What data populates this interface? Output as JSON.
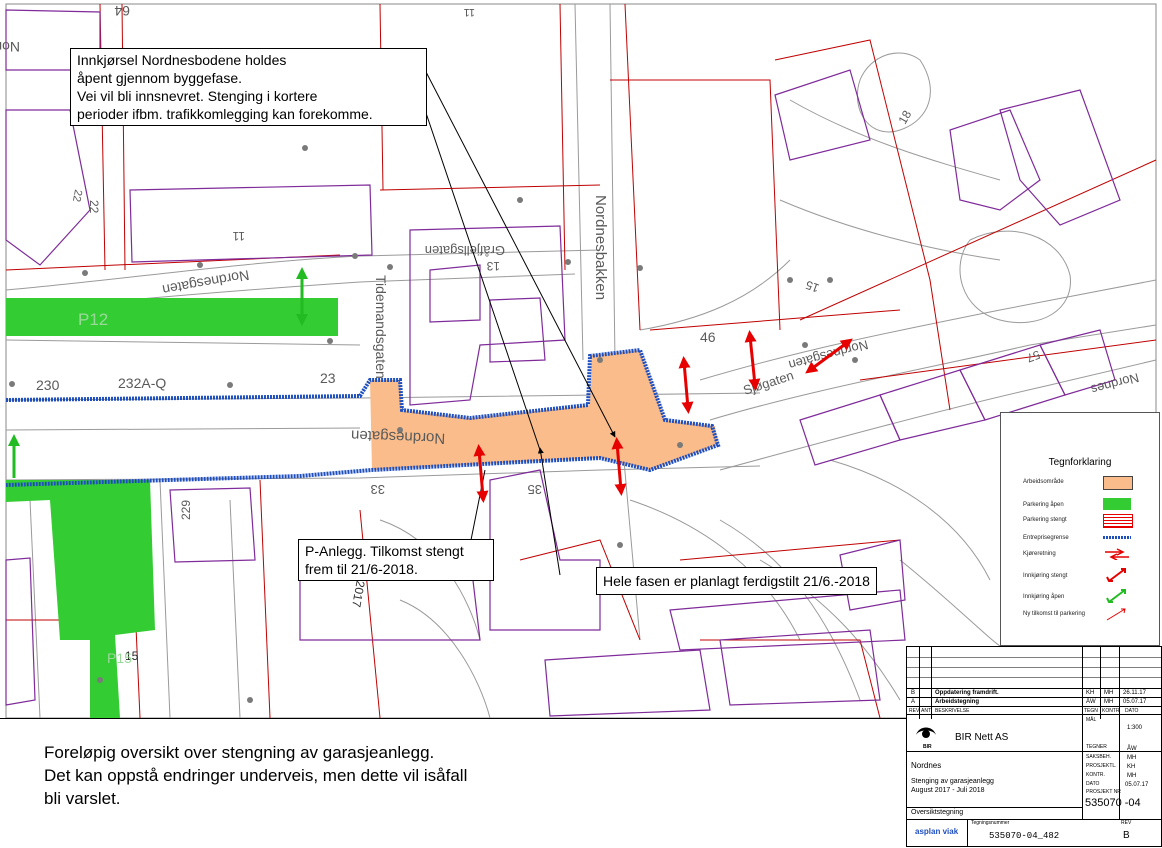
{
  "map": {
    "street_labels": [
      "Nordnesbodene",
      "Nordnesbakken",
      "Tidemandsgaten",
      "Nordnesgaten",
      "Gråfjellsgaten",
      "Nordnesgaten",
      "Sjøgaten",
      "Nordnesgaten",
      "Nordnes"
    ],
    "address_numbers": [
      "64",
      "11",
      "13",
      "22",
      "23",
      "230",
      "232A-Q",
      "33",
      "35",
      "46",
      "15",
      "18",
      "57",
      "22",
      "11",
      "15",
      "229",
      "2017"
    ],
    "area_labels": [
      "P12",
      "P15"
    ],
    "colors": {
      "work_area": "#f9bc8a",
      "parking_open": "#33cc33",
      "boundary": "#1f4fbf",
      "closed_arrow": "#e60000",
      "property_line": "#c00000",
      "building_outline": "#7f2b9a"
    }
  },
  "callouts": {
    "entrance": [
      "Innkjørsel Nordnesbodene holdes",
      "åpent gjennom byggefase.",
      "Vei vil bli innsnevret. Stenging i kortere",
      "perioder ifbm. trafikkomlegging kan forekomme."
    ],
    "parking": [
      "P-Anlegg. Tilkomst stengt",
      "frem til 21/6-2018."
    ],
    "phase": "Hele fasen er planlagt ferdigstilt 21/6.-2018"
  },
  "legend": {
    "title": "Tegnforklaring",
    "items": [
      {
        "label": "Arbeidsområde",
        "symbol": "work-area"
      },
      {
        "label": "Parkering åpen",
        "symbol": "parking-open"
      },
      {
        "label": "Parkering stengt",
        "symbol": "parking-closed"
      },
      {
        "label": "Entreprisegrense",
        "symbol": "boundary"
      },
      {
        "label": "Kjøreretning",
        "symbol": "driving-direction"
      },
      {
        "label": "Innkjøring stengt",
        "symbol": "entry-closed"
      },
      {
        "label": "Innkjøring åpen",
        "symbol": "entry-open"
      },
      {
        "label": "Ny tilkomst til parkering",
        "symbol": "new-access"
      }
    ]
  },
  "bottom_note": [
    "Foreløpig oversikt over stengning av garasjeanlegg.",
    "Det kan oppstå endringer underveis, men dette vil isåfall",
    "bli varslet."
  ],
  "title_block": {
    "revisions": [
      {
        "rev": "B",
        "text": "Oppdatering framdrift.",
        "by": "KH",
        "chk": "MH",
        "date": "26.11.17"
      },
      {
        "rev": "A",
        "text": "Arbeidstegning",
        "by": "ÅW",
        "chk": "MH",
        "date": "05.07.17"
      }
    ],
    "rev_headers": [
      "REV",
      "ANT",
      "BESKRIVELSE",
      "TEGN",
      "KONTR",
      "DATO"
    ],
    "company": "BIR Nett AS",
    "logo_text": "BIR",
    "scale_label": "MÅL",
    "scale": "1:300",
    "roles": [
      {
        "label": "TEGNER",
        "value": "ÅW"
      },
      {
        "label": "SAKSBEH.",
        "value": "MH"
      },
      {
        "label": "PROSJEKTL.",
        "value": "KH"
      },
      {
        "label": "KONTR.",
        "value": "MH"
      },
      {
        "label": "DATO",
        "value": "05.07.17"
      }
    ],
    "location": "Nordnes",
    "project_title": "Stenging av garasjeanlegg",
    "period": "August 2017 - Juli 2018",
    "project_no_label": "PROSJEKT NR",
    "project_no": "535070 -04",
    "drawing_type": "Oversiktstegning",
    "consultant": "asplan viak",
    "drawing_no_label": "Tegningsnummer",
    "drawing_no": "535070-04_482",
    "rev_label": "REV",
    "rev_value": "B"
  }
}
